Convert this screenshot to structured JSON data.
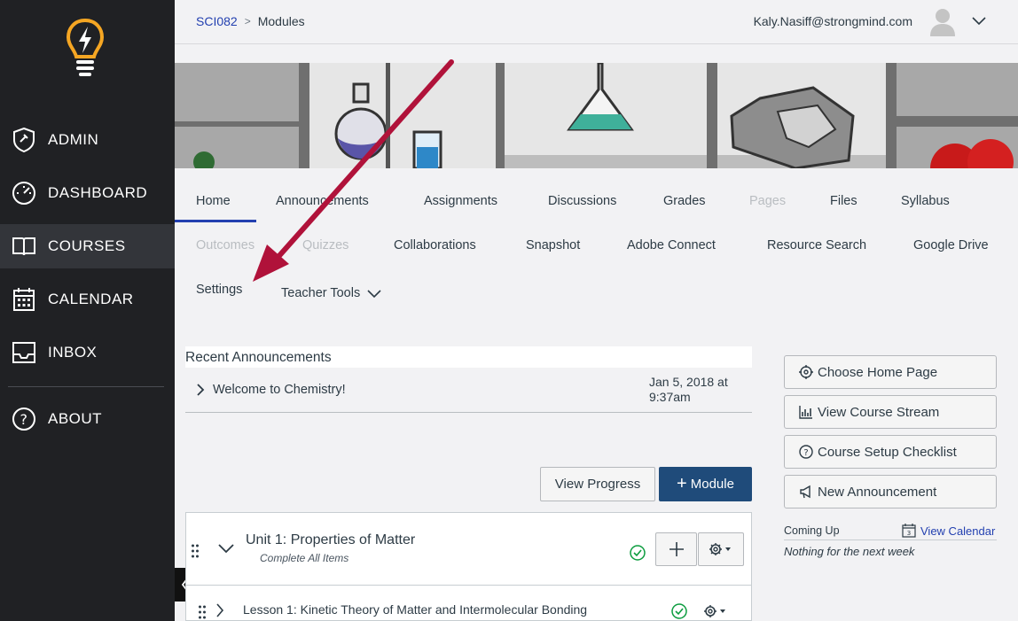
{
  "sidebar": {
    "items": [
      {
        "label": "ADMIN",
        "icon": "admin-icon"
      },
      {
        "label": "DASHBOARD",
        "icon": "dashboard-icon"
      },
      {
        "label": "COURSES",
        "icon": "courses-icon"
      },
      {
        "label": "CALENDAR",
        "icon": "calendar-icon"
      },
      {
        "label": "INBOX",
        "icon": "inbox-icon"
      },
      {
        "label": "ABOUT",
        "icon": "about-icon"
      }
    ]
  },
  "header": {
    "course_code": "SCI082",
    "separator": ">",
    "current": "Modules",
    "user_email": "Kaly.Nasiff@strongmind.com"
  },
  "course_nav": {
    "home": "Home",
    "announcements": "Announcements",
    "assignments": "Assignments",
    "discussions": "Discussions",
    "grades": "Grades",
    "pages": "Pages",
    "files": "Files",
    "syllabus": "Syllabus",
    "outcomes": "Outcomes",
    "quizzes": "Quizzes",
    "collaborations": "Collaborations",
    "snapshot": "Snapshot",
    "adobe_connect": "Adobe Connect",
    "resource_search": "Resource Search",
    "google_drive": "Google Drive",
    "settings": "Settings",
    "teacher_tools": "Teacher Tools"
  },
  "announcements": {
    "header": "Recent Announcements",
    "items": [
      {
        "title": "Welcome to Chemistry!",
        "date_line1": "Jan 5, 2018 at",
        "date_line2": "9:37am"
      }
    ]
  },
  "actions": {
    "view_progress": "View Progress",
    "add_module": "Module"
  },
  "module": {
    "title": "Unit 1: Properties of Matter",
    "requirement": "Complete All Items",
    "lesson_title": "Lesson 1: Kinetic Theory of Matter and Intermolecular Bonding"
  },
  "right_sidebar": {
    "buttons": [
      {
        "label": "Choose Home Page",
        "icon": "target-icon"
      },
      {
        "label": "View Course Stream",
        "icon": "chart-icon"
      },
      {
        "label": "Course Setup Checklist",
        "icon": "question-icon"
      },
      {
        "label": "New Announcement",
        "icon": "megaphone-icon"
      }
    ],
    "coming_up": "Coming Up",
    "view_calendar": "View Calendar",
    "nothing": "Nothing for the next week"
  },
  "colors": {
    "sidebar_bg": "#202124",
    "accent": "#2340b0",
    "module_button": "#1f4b7a",
    "annotation_arrow": "#b0123a"
  }
}
